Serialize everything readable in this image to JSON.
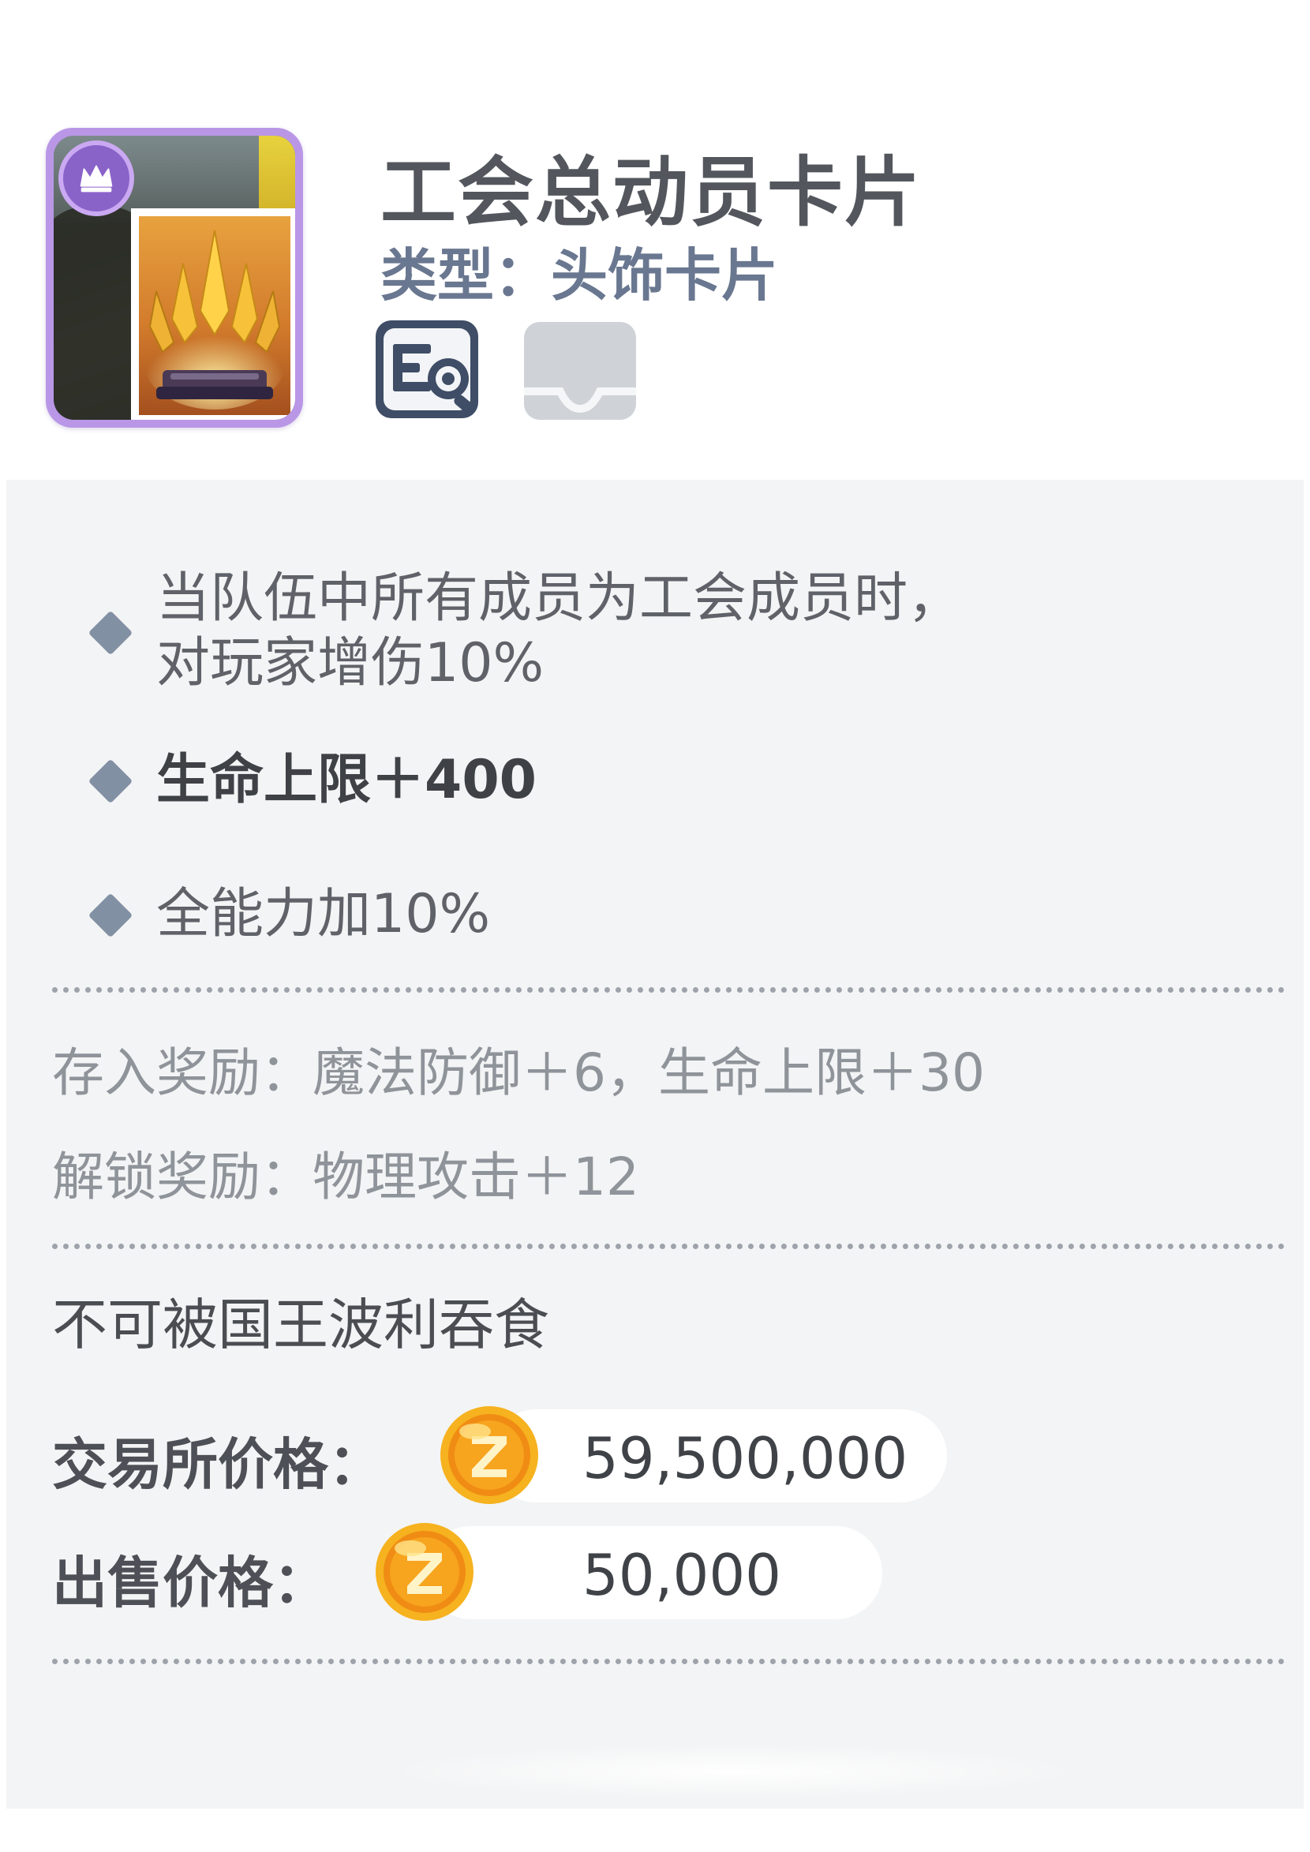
{
  "item": {
    "title": "工会总动员卡片",
    "type_line": "类型：头饰卡片"
  },
  "header_icons": [
    {
      "name": "detail-view-icon"
    },
    {
      "name": "storage-tray-icon"
    }
  ],
  "attributes": [
    {
      "lines": [
        "当队伍中所有成员为工会成员时，",
        "对玩家增伤10%"
      ]
    },
    {
      "lines": [
        "生命上限＋400"
      ]
    },
    {
      "lines": [
        "全能力加10%"
      ]
    }
  ],
  "rewards": {
    "deposit": "存入奖励：魔法防御＋6，生命上限＋30",
    "unlock": "解锁奖励：物理攻击＋12"
  },
  "note": "不可被国王波利吞食",
  "prices": {
    "exchange_label": "交易所价格：",
    "exchange_value": "59,500,000",
    "sell_label": "出售价格：",
    "sell_value": "50,000"
  },
  "colors": {
    "frame_purple": "#b997e6",
    "bullet": "#8290a4",
    "coin_gold": "#f3a51c",
    "panel_bg": "#f3f4f5"
  }
}
